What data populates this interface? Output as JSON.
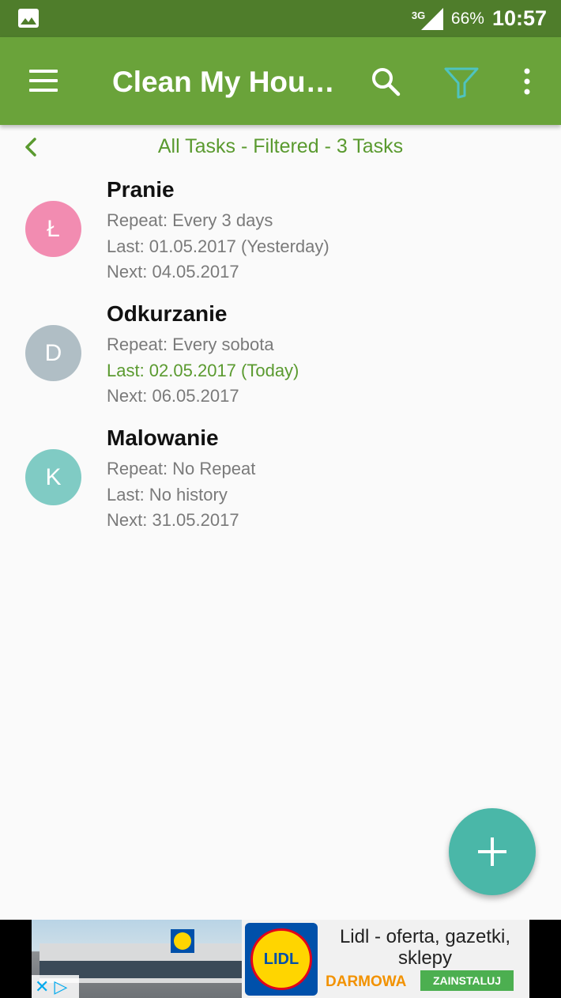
{
  "status_bar": {
    "network": "3G",
    "battery": "66%",
    "time": "10:57"
  },
  "app_bar": {
    "title": "Clean My Hou…",
    "accent_color": "#6aa33a",
    "filter_icon_color": "#4fc3c0"
  },
  "sub_header": {
    "title": "All Tasks - Filtered - 3 Tasks"
  },
  "tasks": [
    {
      "initial": "Ł",
      "avatar_color": "#f28cb1",
      "name": "Pranie",
      "repeat": "Repeat: Every 3 days",
      "last": "Last: 01.05.2017 (Yesterday)",
      "next": "Next: 04.05.2017"
    },
    {
      "initial": "D",
      "avatar_color": "#b0bec5",
      "name": "Odkurzanie",
      "repeat": "Repeat: Every sobota",
      "last": "Last: 02.05.2017 (Today)",
      "next": "Next: 06.05.2017"
    },
    {
      "initial": "K",
      "avatar_color": "#80cbc4",
      "name": "Malowanie",
      "repeat": "Repeat: No Repeat",
      "last": "Last: No history",
      "next": "Next: 31.05.2017"
    }
  ],
  "fab": {
    "icon": "plus-icon",
    "color": "#4ab7a8"
  },
  "ad": {
    "logo_text": "LIDL",
    "title": "Lidl - oferta, gazetki, sklepy",
    "free_label": "DARMOWA",
    "install_label": "ZAINSTALUJ"
  }
}
